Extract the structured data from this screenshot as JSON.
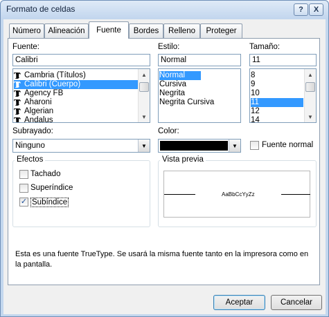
{
  "window": {
    "title": "Formato de celdas",
    "help_label": "?",
    "close_label": "X"
  },
  "tabs": [
    {
      "label": "Número"
    },
    {
      "label": "Alineación"
    },
    {
      "label": "Fuente"
    },
    {
      "label": "Bordes"
    },
    {
      "label": "Relleno"
    },
    {
      "label": "Proteger"
    }
  ],
  "active_tab": "Fuente",
  "font": {
    "label": "Fuente:",
    "value": "Calibri",
    "items": [
      "Cambria (Títulos)",
      "Calibri (Cuerpo)",
      "Agency FB",
      "Aharoni",
      "Algerian",
      "Andalus"
    ],
    "selected": "Calibri (Cuerpo)"
  },
  "style": {
    "label": "Estilo:",
    "value": "Normal",
    "items": [
      "Normal",
      "Cursiva",
      "Negrita",
      "Negrita Cursiva"
    ],
    "selected": "Normal"
  },
  "size": {
    "label": "Tamaño:",
    "value": "11",
    "items": [
      "8",
      "9",
      "10",
      "11",
      "12",
      "14"
    ],
    "selected": "11"
  },
  "underline": {
    "label": "Subrayado:",
    "value": "Ninguno"
  },
  "color": {
    "label": "Color:",
    "swatch": "#000000"
  },
  "normal_font": {
    "label": "Fuente normal",
    "checked": false
  },
  "effects": {
    "label": "Efectos",
    "items": [
      {
        "label": "Tachado",
        "checked": false
      },
      {
        "label": "Superíndice",
        "checked": false
      },
      {
        "label": "Subíndice",
        "checked": true
      }
    ]
  },
  "preview": {
    "label": "Vista previa",
    "sample": "AaBbCcYyZz"
  },
  "info_text": "Esta es una fuente TrueType. Se usará la misma fuente tanto en la impresora como en la pantalla.",
  "buttons": {
    "ok": "Aceptar",
    "cancel": "Cancelar"
  },
  "colors": {
    "selection": "#3399ff",
    "titlebar": "#c2d6ee"
  }
}
